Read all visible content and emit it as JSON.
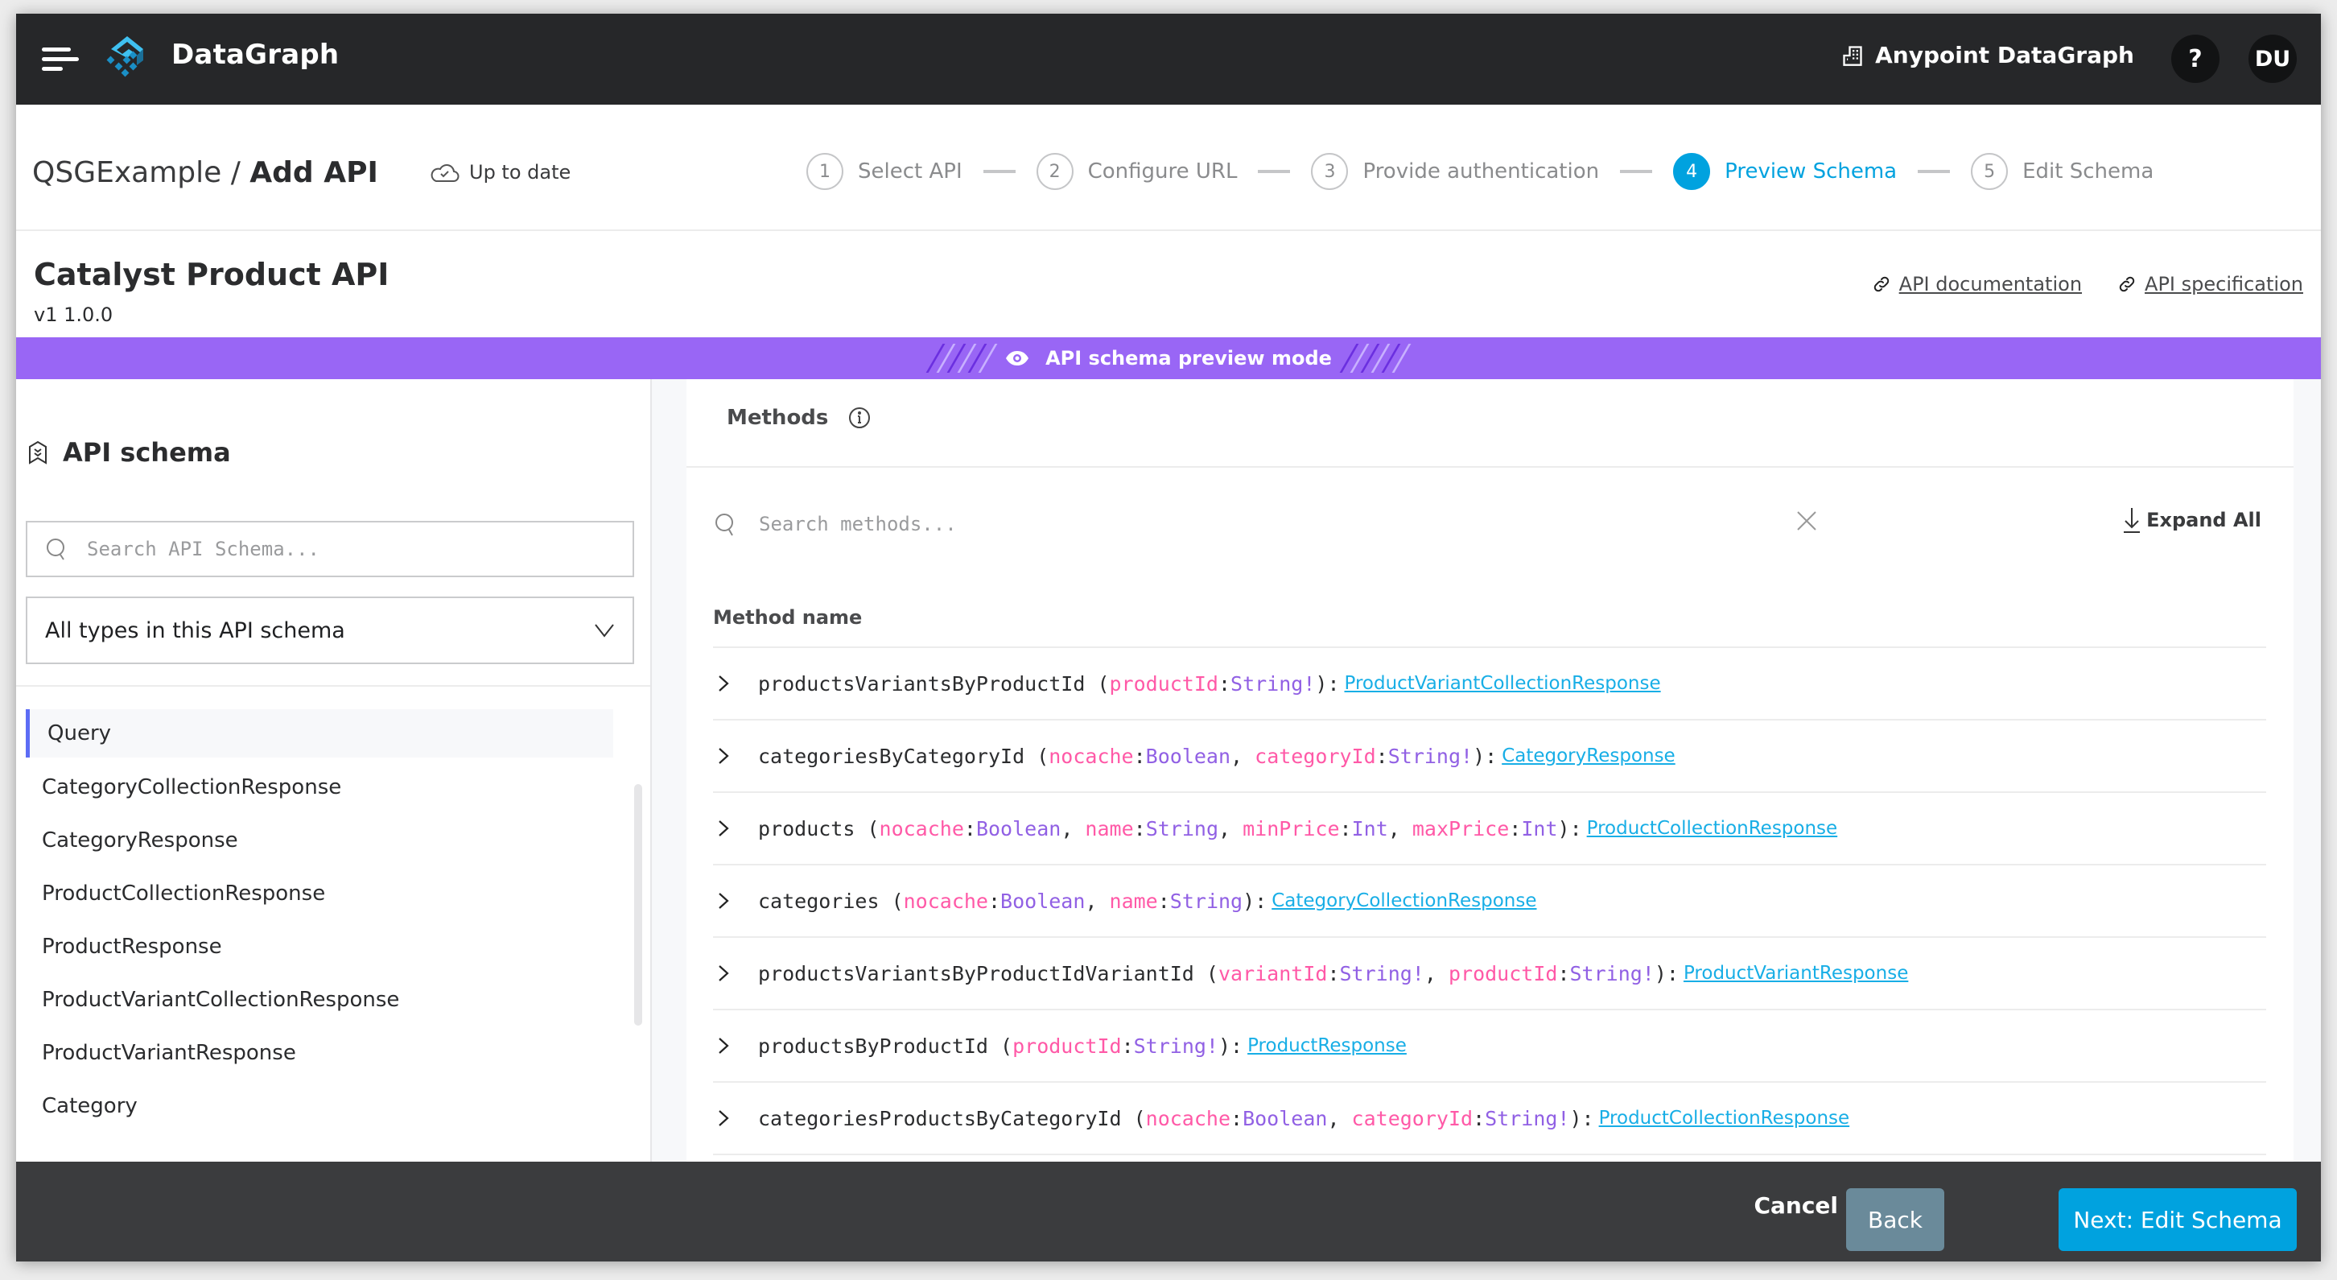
{
  "topbar": {
    "menu_icon": "hamburger-menu-icon",
    "logo_icon": "datagraph-logo-icon",
    "brand": "DataGraph",
    "org_icon": "building-icon",
    "org_name": "Anypoint DataGraph",
    "help_label": "?",
    "avatar_initials": "DU"
  },
  "page_header": {
    "breadcrumb_parent": "QSGExample /",
    "breadcrumb_current": "Add API",
    "status_icon": "cloud-check-icon",
    "status_text": "Up to date",
    "steps": [
      {
        "number": "1",
        "label": "Select API",
        "state": "done"
      },
      {
        "number": "2",
        "label": "Configure URL",
        "state": "done"
      },
      {
        "number": "3",
        "label": "Provide authentication",
        "state": "done"
      },
      {
        "number": "4",
        "label": "Preview Schema",
        "state": "active"
      },
      {
        "number": "5",
        "label": "Edit Schema",
        "state": "pending"
      }
    ]
  },
  "api": {
    "title": "Catalyst Product API",
    "version": "v1 1.0.0",
    "links": [
      {
        "icon": "link-icon",
        "label": "API documentation"
      },
      {
        "icon": "link-icon",
        "label": "API specification"
      }
    ]
  },
  "banner": {
    "icon": "eye-icon",
    "text": "API schema preview mode",
    "color": "#9966f5"
  },
  "sidebar": {
    "title": "API schema",
    "title_icon": "schema-bookmark-icon",
    "search_placeholder": "Search API Schema...",
    "search_value": "",
    "filter_selected": "All types in this API schema",
    "items": [
      {
        "label": "Query",
        "active": true
      },
      {
        "label": "CategoryCollectionResponse"
      },
      {
        "label": "CategoryResponse"
      },
      {
        "label": "ProductCollectionResponse"
      },
      {
        "label": "ProductResponse"
      },
      {
        "label": "ProductVariantCollectionResponse"
      },
      {
        "label": "ProductVariantResponse"
      },
      {
        "label": "Category"
      }
    ]
  },
  "methods": {
    "title": "Methods",
    "search_placeholder": "Search methods...",
    "search_value": "",
    "expand_all_label": "Expand All",
    "column_header": "Method name",
    "rows": [
      {
        "name": "productsVariantsByProductId",
        "params": [
          {
            "name": "productId",
            "type": "String!"
          }
        ],
        "returns": "ProductVariantCollectionResponse"
      },
      {
        "name": "categoriesByCategoryId",
        "params": [
          {
            "name": "nocache",
            "type": "Boolean"
          },
          {
            "name": "categoryId",
            "type": "String!"
          }
        ],
        "returns": "CategoryResponse"
      },
      {
        "name": "products",
        "params": [
          {
            "name": "nocache",
            "type": "Boolean"
          },
          {
            "name": "name",
            "type": "String"
          },
          {
            "name": "minPrice",
            "type": "Int"
          },
          {
            "name": "maxPrice",
            "type": "Int"
          }
        ],
        "returns": "ProductCollectionResponse"
      },
      {
        "name": "categories",
        "params": [
          {
            "name": "nocache",
            "type": "Boolean"
          },
          {
            "name": "name",
            "type": "String"
          }
        ],
        "returns": "CategoryCollectionResponse"
      },
      {
        "name": "productsVariantsByProductIdVariantId",
        "params": [
          {
            "name": "variantId",
            "type": "String!"
          },
          {
            "name": "productId",
            "type": "String!"
          }
        ],
        "returns": "ProductVariantResponse"
      },
      {
        "name": "productsByProductId",
        "params": [
          {
            "name": "productId",
            "type": "String!"
          }
        ],
        "returns": "ProductResponse"
      },
      {
        "name": "categoriesProductsByCategoryId",
        "params": [
          {
            "name": "nocache",
            "type": "Boolean"
          },
          {
            "name": "categoryId",
            "type": "String!"
          }
        ],
        "returns": "ProductCollectionResponse"
      }
    ]
  },
  "footer": {
    "cancel_label": "Cancel",
    "back_label": "Back",
    "next_label": "Next: Edit Schema"
  },
  "colors": {
    "accent": "#00a2df",
    "param_name": "#ff59a7",
    "param_type": "#9160e4",
    "link": "#18aee6",
    "topbar": "#262729",
    "footer": "#3b3c3e"
  }
}
